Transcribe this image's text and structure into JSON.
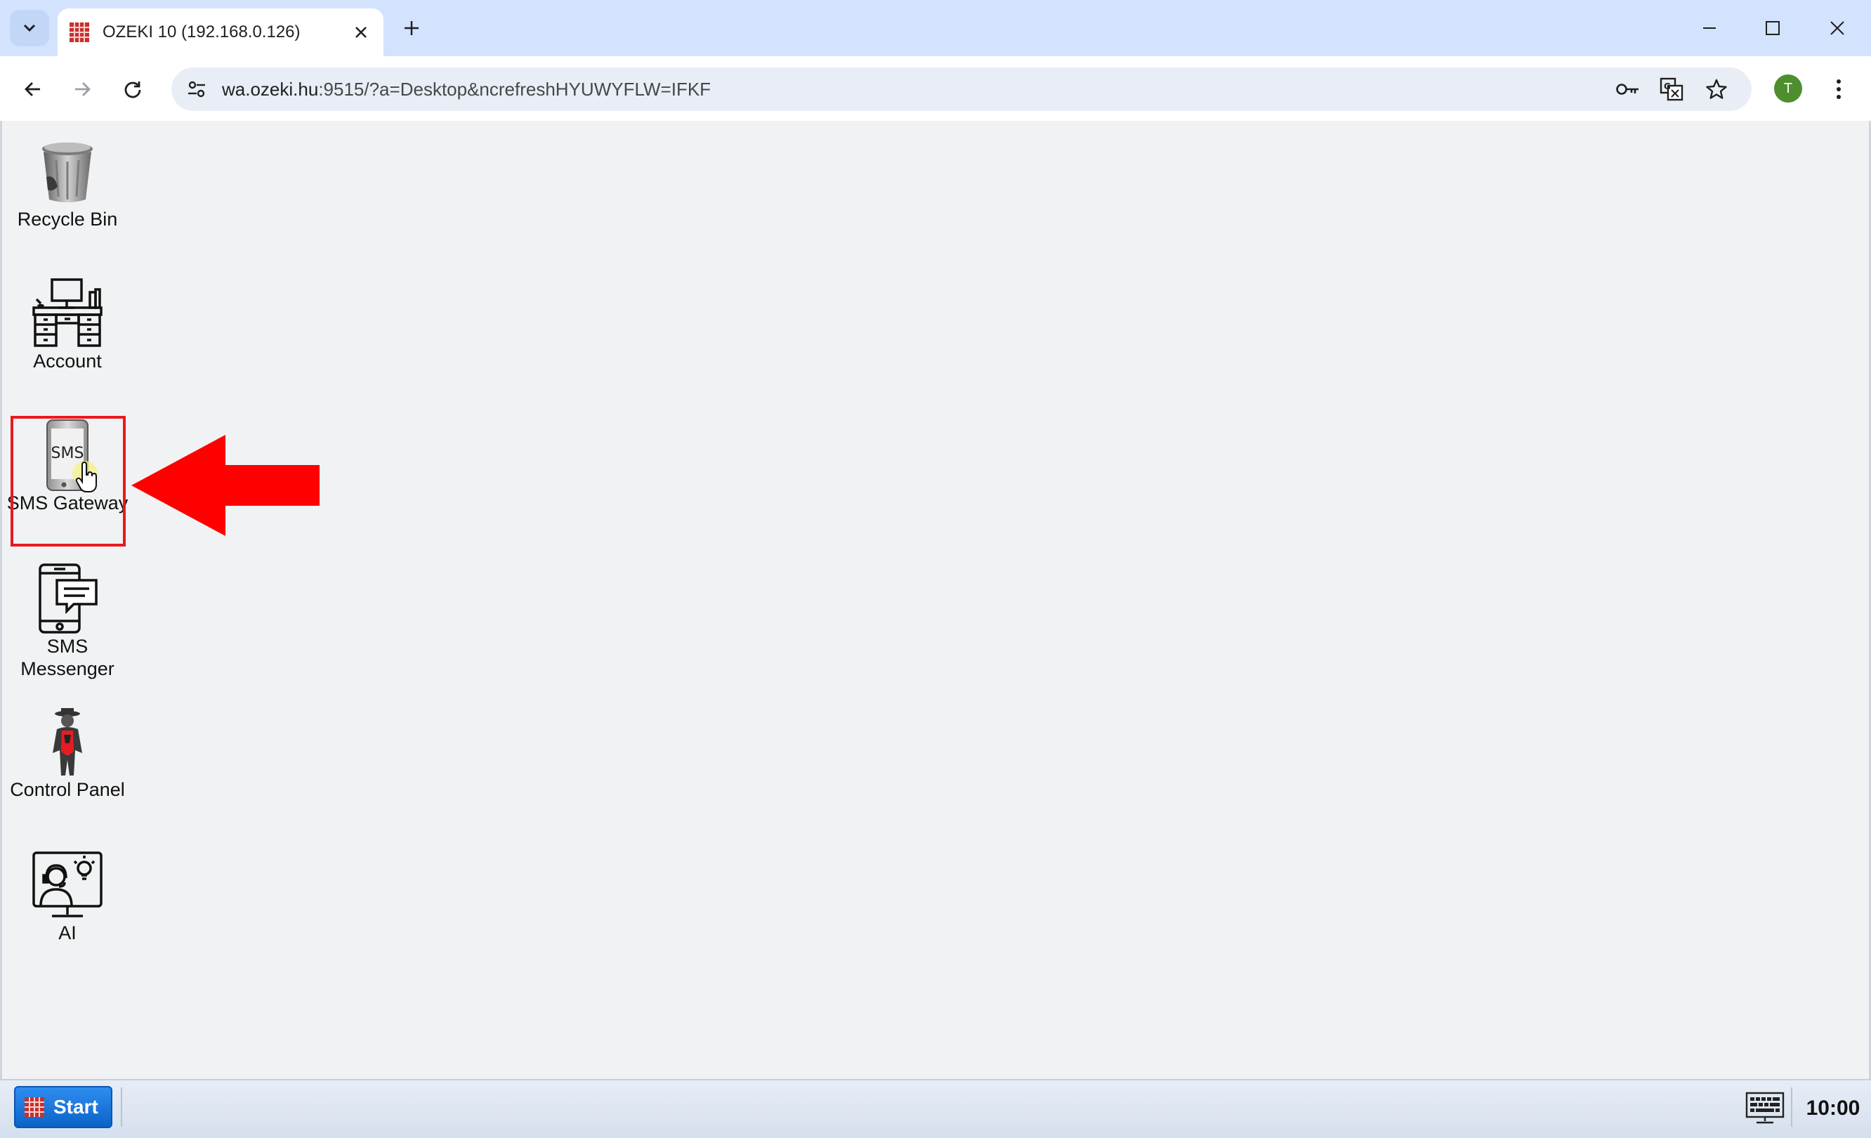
{
  "browser": {
    "tab_title": "OZEKI 10 (192.168.0.126)",
    "url_host": "wa.ozeki.hu",
    "url_rest": ":9515/?a=Desktop&ncrefreshHYUWYFLW=IFKF",
    "profile_initial": "T"
  },
  "desktop": {
    "icons": [
      {
        "label": "Recycle Bin",
        "icon": "recycle-bin-icon"
      },
      {
        "label": "Account",
        "icon": "account-desk-icon"
      },
      {
        "label": "SMS Gateway",
        "icon": "sms-gateway-icon",
        "highlighted": true
      },
      {
        "label": "SMS Messenger",
        "icon": "sms-messenger-icon"
      },
      {
        "label": "Control Panel",
        "icon": "control-panel-icon"
      },
      {
        "label": "AI",
        "icon": "ai-icon"
      }
    ],
    "annotation": {
      "type": "arrow",
      "color": "#ff0000",
      "points_to": "SMS Gateway"
    }
  },
  "taskbar": {
    "start_label": "Start",
    "clock": "10:00"
  },
  "colors": {
    "tabstrip": "#d3e3fd",
    "desktop": "#f1f2f3",
    "highlight": "#e8191f",
    "start_button": "#1a74dd",
    "profile": "#4e8e2e"
  }
}
